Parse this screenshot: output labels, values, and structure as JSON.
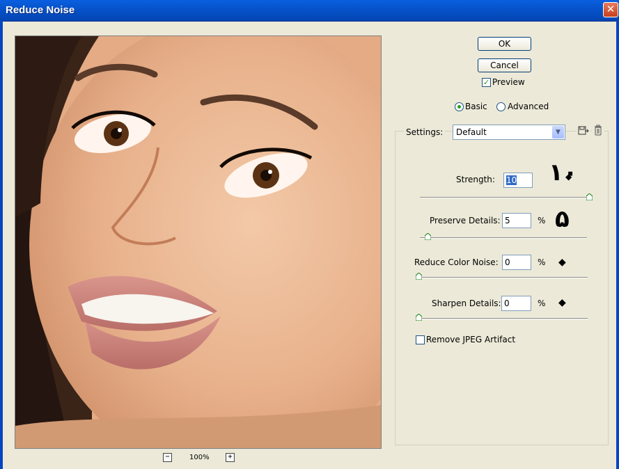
{
  "window": {
    "title": "Reduce Noise",
    "close_symbol": "✕"
  },
  "preview": {
    "zoom_level": "100%",
    "zoom_out_symbol": "−",
    "zoom_in_symbol": "+"
  },
  "buttons": {
    "ok": "OK",
    "cancel": "Cancel"
  },
  "preview_checkbox": {
    "label": "Preview",
    "checked": true,
    "mark": "✓"
  },
  "mode": {
    "basic_label": "Basic",
    "advanced_label": "Advanced",
    "selected": "Basic"
  },
  "settings": {
    "label": "Settings:",
    "value": "Default",
    "arrow": "▼"
  },
  "controls": {
    "strength": {
      "label": "Strength:",
      "value": "10",
      "level": 1.0
    },
    "preserve_details": {
      "label": "Preserve Details:",
      "value": "5",
      "unit": "%",
      "level": 0.05
    },
    "reduce_color_noise": {
      "label": "Reduce Color Noise:",
      "value": "0",
      "unit": "%",
      "level": 0.0
    },
    "sharpen_details": {
      "label": "Sharpen Details:",
      "value": "0",
      "unit": "%",
      "level": 0.0
    }
  },
  "remove_jpeg": {
    "label": "Remove JPEG Artifact",
    "checked": false
  },
  "annotations": {
    "strength_note": "۱۰",
    "preserve_note": "۵",
    "diamond": "◆"
  },
  "icons": {
    "save_settings": "save-settings-icon",
    "delete_settings": "trash-icon"
  },
  "colors": {
    "titlebar": "#0551c6",
    "accent_check": "#21a121",
    "selection": "#316ac5"
  }
}
